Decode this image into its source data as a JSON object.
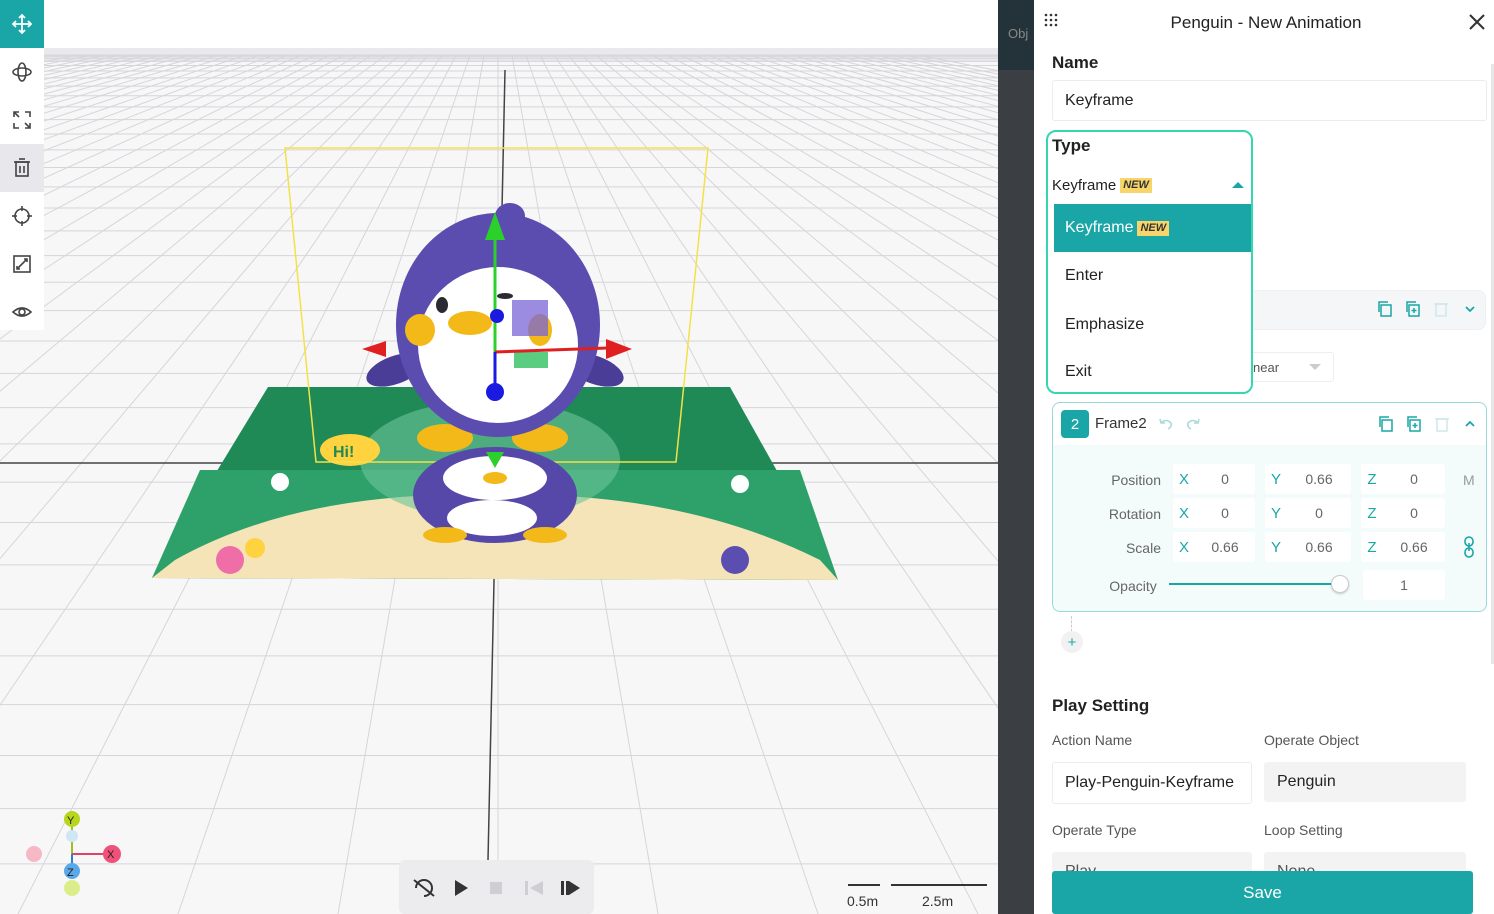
{
  "viewport": {
    "scale_small": "0.5m",
    "scale_large": "2.5m",
    "axis_labels": {
      "y": "Y",
      "x": "X",
      "z": "Z"
    },
    "toolbar": [
      {
        "icon": "move-icon",
        "active": true
      },
      {
        "icon": "rotate-icon"
      },
      {
        "icon": "scale-icon"
      },
      {
        "icon": "delete-icon"
      },
      {
        "icon": "target-icon"
      },
      {
        "icon": "fit-icon"
      },
      {
        "icon": "eye-icon"
      }
    ],
    "playback": [
      "loop-off-icon",
      "play-icon",
      "stop-icon",
      "prev-frame-icon",
      "next-frame-icon"
    ],
    "mat_text": {
      "hi": "Hi!"
    }
  },
  "strip": {
    "tab_label": "Obj"
  },
  "panel": {
    "title": "Penguin - New Animation",
    "name_label": "Name",
    "name_value": "Keyframe",
    "type_label": "Type",
    "type_value": "Keyframe",
    "new_badge": "NEW",
    "type_options": [
      {
        "label": "Keyframe",
        "badge": "NEW",
        "selected": true
      },
      {
        "label": "Enter"
      },
      {
        "label": "Emphasize"
      },
      {
        "label": "Exit"
      }
    ],
    "easing_partial": "near",
    "frame2": {
      "index": "2",
      "name": "Frame2",
      "position_label": "Position",
      "rotation_label": "Rotation",
      "scale_label": "Scale",
      "opacity_label": "Opacity",
      "position": {
        "x": "0",
        "y": "0.66",
        "z": "0"
      },
      "rotation": {
        "x": "0",
        "y": "0",
        "z": "0"
      },
      "scale": {
        "x": "0.66",
        "y": "0.66",
        "z": "0.66"
      },
      "opacity": "1",
      "opacity_fraction": 0.97,
      "unit": "M",
      "axis": {
        "x": "X",
        "y": "Y",
        "z": "Z"
      }
    },
    "add_frame": "+",
    "play_setting": {
      "heading": "Play Setting",
      "action_name_label": "Action Name",
      "action_name_value": "Play-Penguin-Keyframe",
      "operate_object_label": "Operate Object",
      "operate_object_value": "Penguin",
      "operate_type_label": "Operate Type",
      "operate_type_value": "Play",
      "loop_setting_label": "Loop Setting",
      "loop_setting_value": "None"
    },
    "save_label": "Save"
  },
  "colors": {
    "accent": "#1aa6a6",
    "dropdown_border": "#36d6b0",
    "badge": "#f7d56b"
  }
}
